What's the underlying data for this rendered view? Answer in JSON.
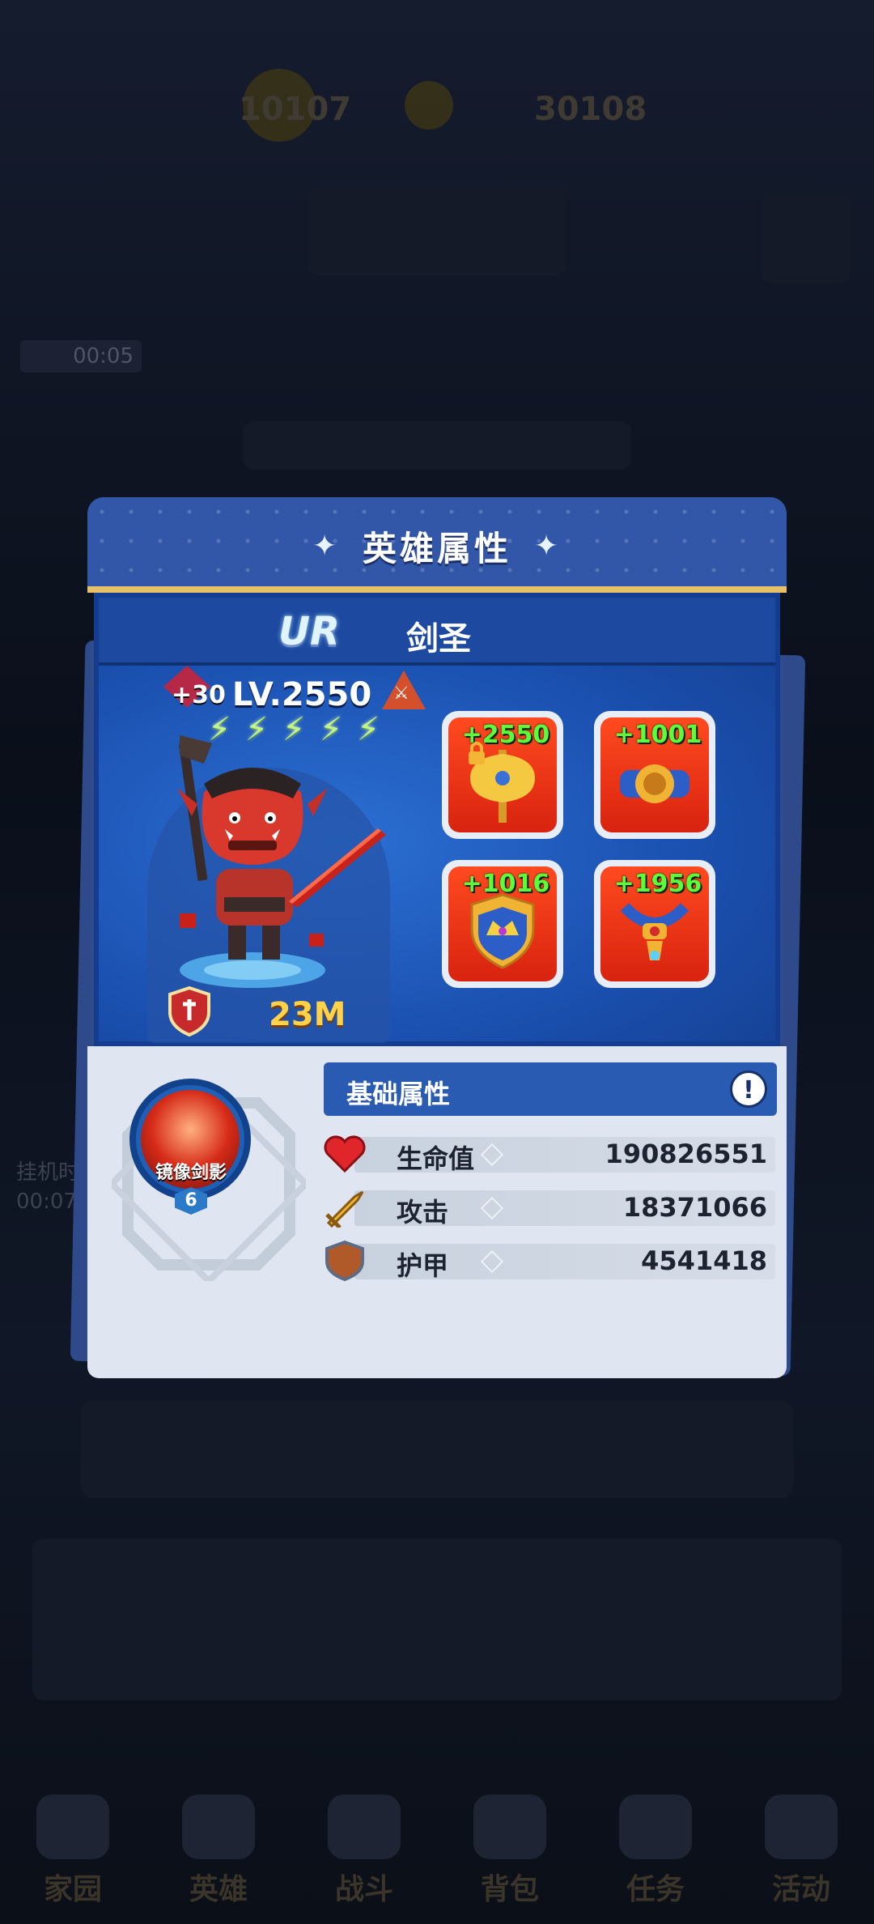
{
  "background": {
    "currency_left": "10107",
    "currency_right": "30108",
    "timer": "00:05",
    "side_text": [
      "挂机时",
      "00:07"
    ],
    "tabs": [
      "家园",
      "英雄",
      "战斗",
      "背包",
      "任务",
      "活动"
    ]
  },
  "modal": {
    "title": "英雄属性",
    "rarity": "UR",
    "hero_name": "剑圣",
    "star_bonus": "+30",
    "level": "LV.2550",
    "energy_bolts": 5,
    "power": "23M",
    "equipment": [
      {
        "name": "axe",
        "bonus": "+2550",
        "locked": true
      },
      {
        "name": "belt",
        "bonus": "+1001",
        "locked": false
      },
      {
        "name": "crown-shield",
        "bonus": "+1016",
        "locked": false
      },
      {
        "name": "amulet",
        "bonus": "+1956",
        "locked": false
      }
    ],
    "skill": {
      "name": "镜像剑影",
      "level": "6"
    },
    "basic_attributes": {
      "title": "基础属性",
      "info_label": "!",
      "stats": [
        {
          "label": "生命值",
          "value": "190826551",
          "icon": "heart-icon",
          "color": "#e0262b"
        },
        {
          "label": "攻击",
          "value": "18371066",
          "icon": "sword-icon",
          "color": "#e8a21a"
        },
        {
          "label": "护甲",
          "value": "4541418",
          "icon": "armor-icon",
          "color": "#b05a2a"
        }
      ]
    }
  }
}
